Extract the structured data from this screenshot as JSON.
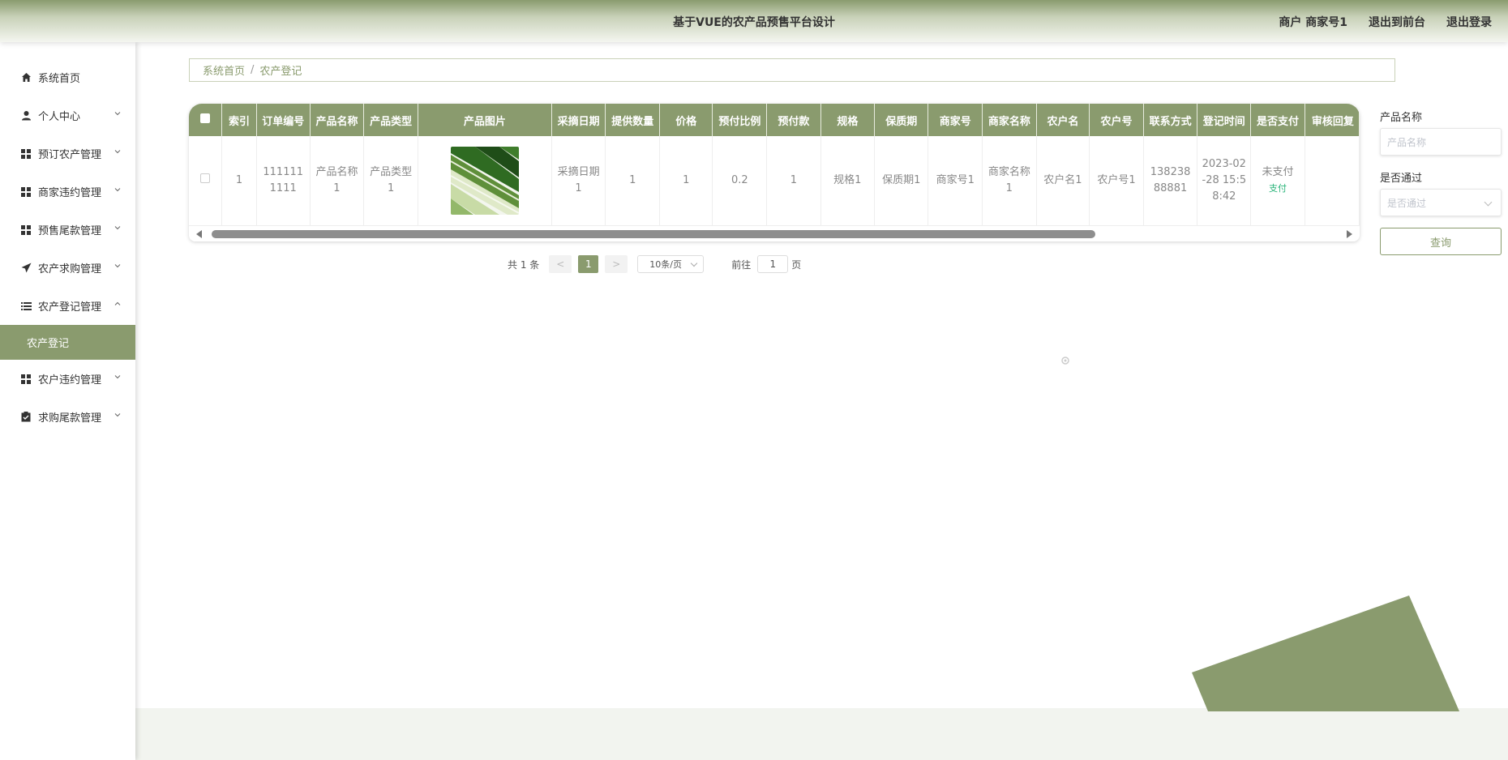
{
  "header": {
    "title": "基于VUE的农产品预售平台设计",
    "user_label": "商户 商家号1",
    "back_front": "退出到前台",
    "logout": "退出登录"
  },
  "sidebar": {
    "items": [
      {
        "label": "系统首页",
        "icon": "home-icon"
      },
      {
        "label": "个人中心",
        "icon": "user-icon"
      },
      {
        "label": "预订农产管理",
        "icon": "grid-icon"
      },
      {
        "label": "商家违约管理",
        "icon": "grid-icon"
      },
      {
        "label": "预售尾款管理",
        "icon": "grid-icon"
      },
      {
        "label": "农产求购管理",
        "icon": "send-icon"
      },
      {
        "label": "农产登记管理",
        "icon": "list-icon"
      },
      {
        "label": "农产登记",
        "icon": ""
      },
      {
        "label": "农户违约管理",
        "icon": "grid-icon"
      },
      {
        "label": "求购尾款管理",
        "icon": "clipboard-icon"
      }
    ]
  },
  "breadcrumb": {
    "home": "系统首页",
    "sep": "/",
    "current": "农产登记"
  },
  "table": {
    "columns": [
      "索引",
      "订单编号",
      "产品名称",
      "产品类型",
      "产品图片",
      "采摘日期",
      "提供数量",
      "价格",
      "预付比例",
      "预付款",
      "规格",
      "保质期",
      "商家号",
      "商家名称",
      "农户名",
      "农户号",
      "联系方式",
      "登记时间",
      "是否支付",
      "审核回复"
    ],
    "row": {
      "index": "1",
      "order_no": "1111111111",
      "product_name": "产品名称1",
      "product_type": "产品类型1",
      "picture": "leek-image",
      "pick_date": "采摘日期1",
      "quantity": "1",
      "price": "1",
      "prepay_ratio": "0.2",
      "prepay": "1",
      "spec": "规格1",
      "shelf_life": "保质期1",
      "merchant_no": "商家号1",
      "merchant_name": "商家名称1",
      "farmer_name": "农户名1",
      "farmer_no": "农户号1",
      "contact": "13823888881",
      "reg_time": "2023-02-28 15:58:42",
      "paid": "未支付",
      "pay_action": "支付",
      "review": ""
    }
  },
  "pagination": {
    "total": "共 1 条",
    "prev": "<",
    "page": "1",
    "next": ">",
    "size": "10条/页",
    "goto_prefix": "前往",
    "goto_value": "1",
    "goto_suffix": "页"
  },
  "filter": {
    "name_label": "产品名称",
    "name_placeholder": "产品名称",
    "pass_label": "是否通过",
    "pass_placeholder": "是否通过",
    "query": "查询"
  },
  "colors": {
    "accent": "#8a9b6e",
    "pay_link": "#2ab47a"
  }
}
